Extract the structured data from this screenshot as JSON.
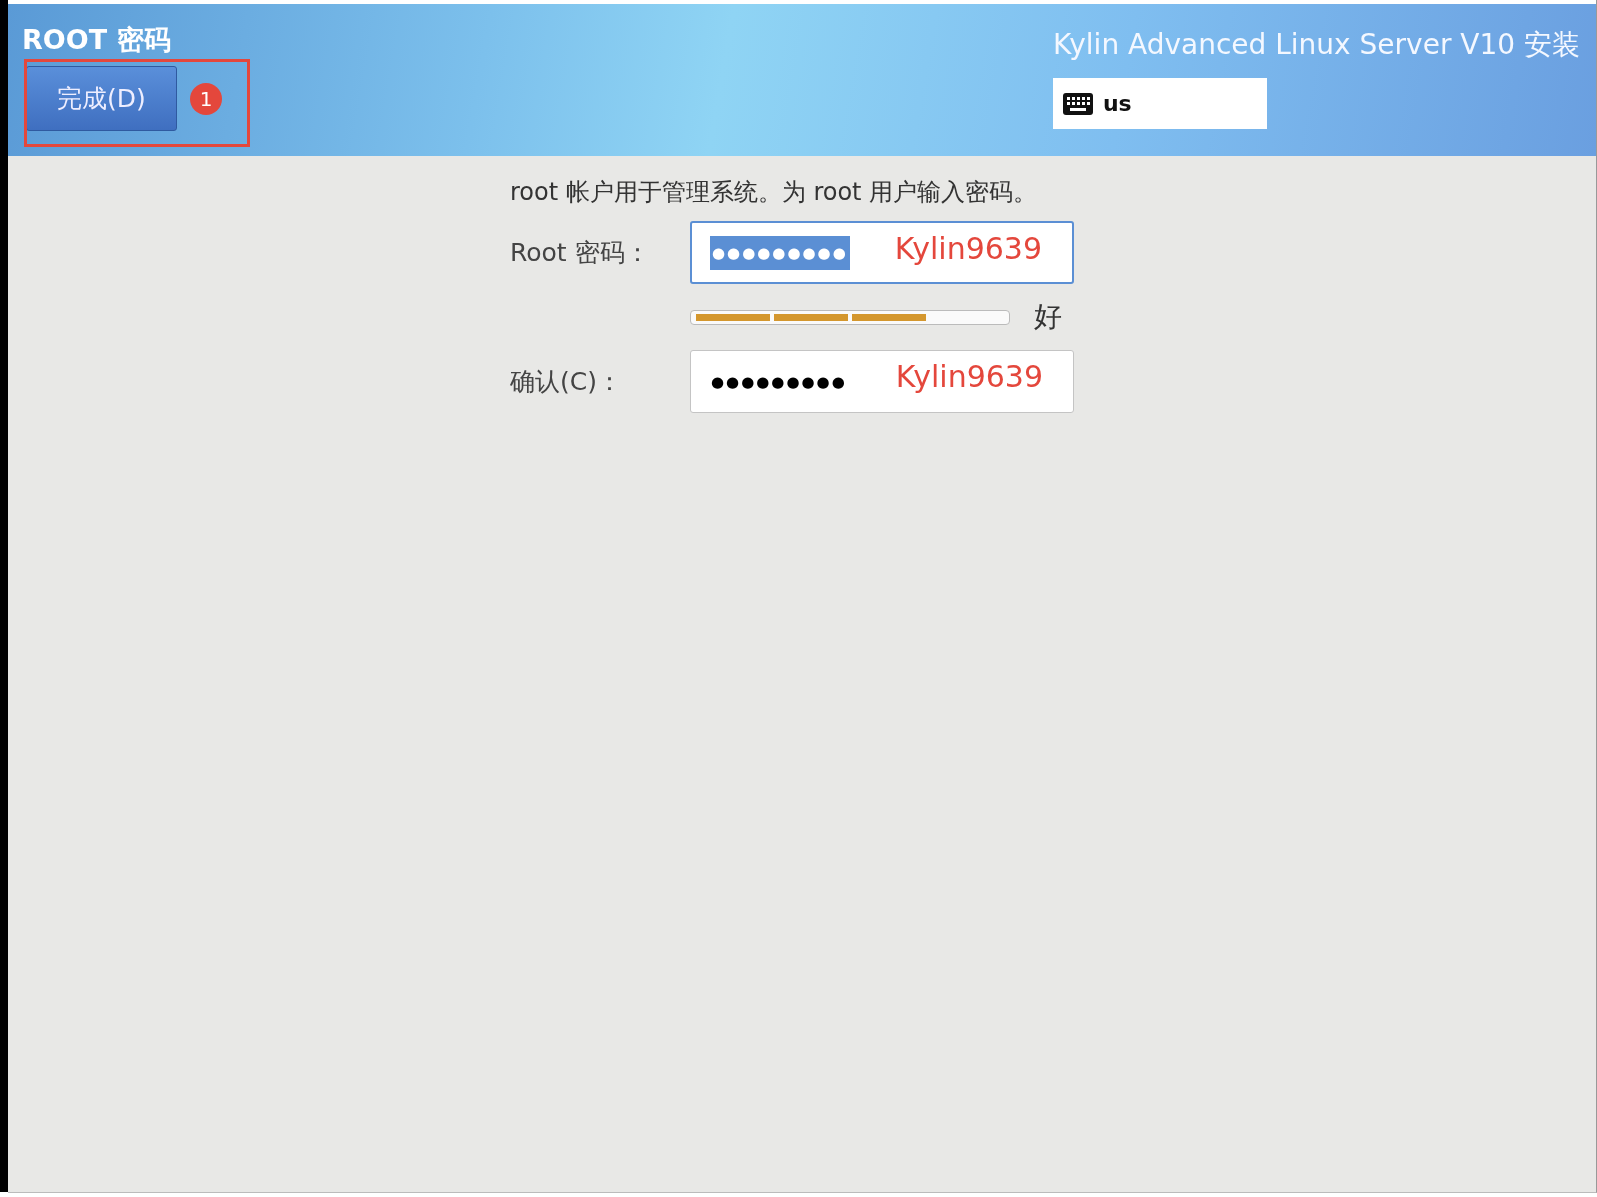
{
  "header": {
    "title": "ROOT 密码",
    "done_button": "完成(D)",
    "product_title": "Kylin Advanced Linux Server V10 安装",
    "keyboard_layout": "us"
  },
  "form": {
    "description": "root 帐户用于管理系统。为 root 用户输入密码。",
    "password": {
      "label": "Root 密码：",
      "value": "●●●●●●●●●",
      "focused": true,
      "text_selected": true,
      "annotation": "Kylin9639"
    },
    "strength": {
      "level": 0.75,
      "label": "好"
    },
    "confirm": {
      "label": "确认(C)：",
      "value": "●●●●●●●●●",
      "focused": false,
      "text_selected": false,
      "annotation": "Kylin9639"
    }
  },
  "annotations": {
    "step_badge": "1",
    "highlight_box": true
  }
}
